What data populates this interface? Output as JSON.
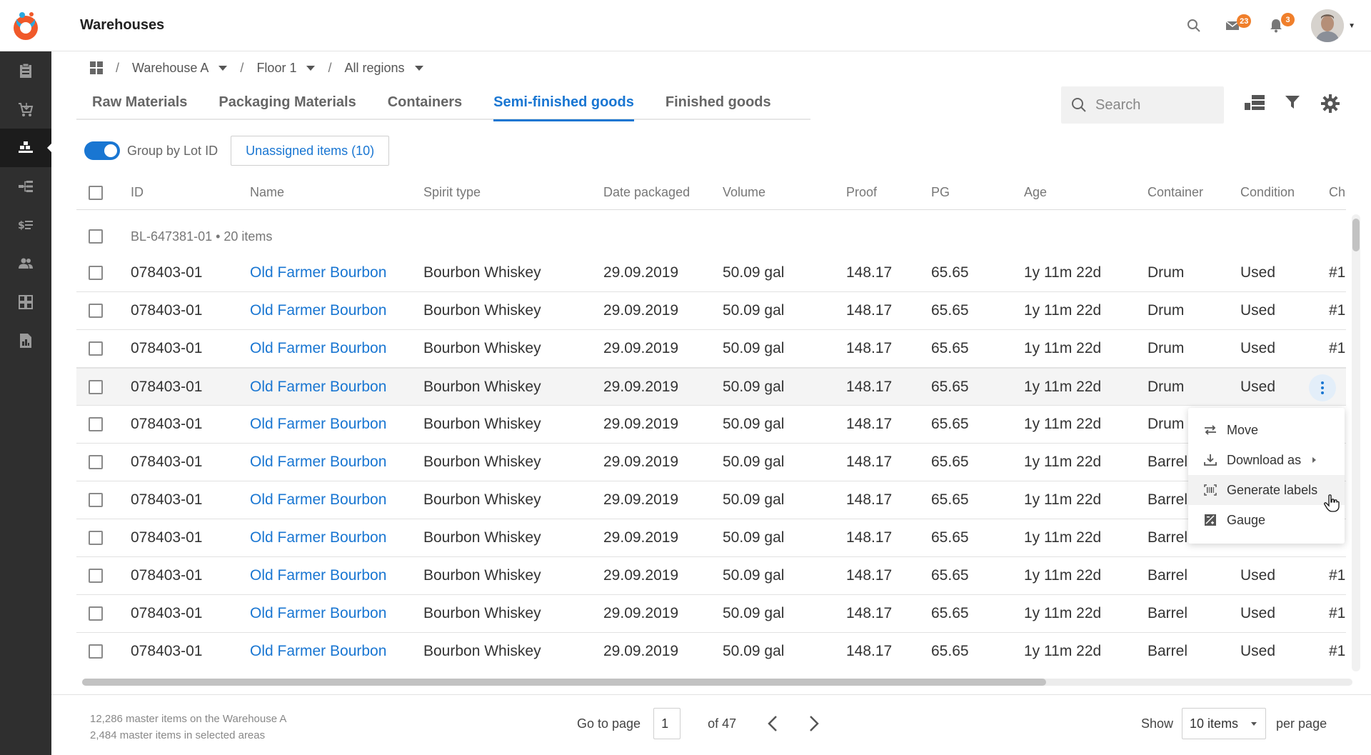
{
  "app": {
    "title": "Warehouses"
  },
  "topbar": {
    "search_icon": "search-icon",
    "mail_count": "23",
    "bell_count": "3"
  },
  "sidebar": {
    "items": [
      {
        "name": "clipboard-icon",
        "active": false
      },
      {
        "name": "cart-icon",
        "active": false
      },
      {
        "name": "warehouse-icon",
        "active": true
      },
      {
        "name": "hierarchy-icon",
        "active": false
      },
      {
        "name": "price-list-icon",
        "active": false
      },
      {
        "name": "users-icon",
        "active": false
      },
      {
        "name": "dashboard-icon",
        "active": false
      },
      {
        "name": "document-icon",
        "active": false
      }
    ]
  },
  "breadcrumb": {
    "warehouse": "Warehouse A",
    "floor": "Floor 1",
    "region": "All regions",
    "separator": "/"
  },
  "tabs": [
    {
      "label": "Raw Materials",
      "active": false
    },
    {
      "label": "Packaging Materials",
      "active": false
    },
    {
      "label": "Containers",
      "active": false
    },
    {
      "label": "Semi-finished goods",
      "active": true
    },
    {
      "label": "Finished goods",
      "active": false
    }
  ],
  "search": {
    "placeholder": "Search"
  },
  "toolbar": {
    "group_label": "Group by Lot ID",
    "group_enabled": true,
    "unassigned_label": "Unassigned items (10)"
  },
  "table": {
    "columns": [
      "ID",
      "Name",
      "Spirit type",
      "Date packaged",
      "Volume",
      "Proof",
      "PG",
      "Age",
      "Container",
      "Condition",
      "Ch"
    ],
    "group_label": "BL-647381-01 • 20 items",
    "rows": [
      [
        "078403-01",
        "Old Farmer Bourbon",
        "Bourbon Whiskey",
        "29.09.2019",
        "50.09 gal",
        "148.17",
        "65.65",
        "1y 11m 22d",
        "Drum",
        "Used",
        "#1"
      ],
      [
        "078403-01",
        "Old Farmer Bourbon",
        "Bourbon Whiskey",
        "29.09.2019",
        "50.09 gal",
        "148.17",
        "65.65",
        "1y 11m 22d",
        "Drum",
        "Used",
        "#1"
      ],
      [
        "078403-01",
        "Old Farmer Bourbon",
        "Bourbon Whiskey",
        "29.09.2019",
        "50.09 gal",
        "148.17",
        "65.65",
        "1y 11m 22d",
        "Drum",
        "Used",
        "#1"
      ],
      [
        "078403-01",
        "Old Farmer Bourbon",
        "Bourbon Whiskey",
        "29.09.2019",
        "50.09 gal",
        "148.17",
        "65.65",
        "1y 11m 22d",
        "Drum",
        "Used",
        ""
      ],
      [
        "078403-01",
        "Old Farmer Bourbon",
        "Bourbon Whiskey",
        "29.09.2019",
        "50.09 gal",
        "148.17",
        "65.65",
        "1y 11m 22d",
        "Drum",
        "",
        ""
      ],
      [
        "078403-01",
        "Old Farmer Bourbon",
        "Bourbon Whiskey",
        "29.09.2019",
        "50.09 gal",
        "148.17",
        "65.65",
        "1y 11m 22d",
        "Barrel",
        "",
        ""
      ],
      [
        "078403-01",
        "Old Farmer Bourbon",
        "Bourbon Whiskey",
        "29.09.2019",
        "50.09 gal",
        "148.17",
        "65.65",
        "1y 11m 22d",
        "Barrel",
        "",
        ""
      ],
      [
        "078403-01",
        "Old Farmer Bourbon",
        "Bourbon Whiskey",
        "29.09.2019",
        "50.09 gal",
        "148.17",
        "65.65",
        "1y 11m 22d",
        "Barrel",
        "",
        ""
      ],
      [
        "078403-01",
        "Old Farmer Bourbon",
        "Bourbon Whiskey",
        "29.09.2019",
        "50.09 gal",
        "148.17",
        "65.65",
        "1y 11m 22d",
        "Barrel",
        "Used",
        "#1"
      ],
      [
        "078403-01",
        "Old Farmer Bourbon",
        "Bourbon Whiskey",
        "29.09.2019",
        "50.09 gal",
        "148.17",
        "65.65",
        "1y 11m 22d",
        "Barrel",
        "Used",
        "#1"
      ],
      [
        "078403-01",
        "Old Farmer Bourbon",
        "Bourbon Whiskey",
        "29.09.2019",
        "50.09 gal",
        "148.17",
        "65.65",
        "1y 11m 22d",
        "Barrel",
        "Used",
        "#1"
      ]
    ],
    "hovered_row_index": 3
  },
  "context_menu": {
    "items": [
      {
        "label": "Move",
        "icon": "swap-icon",
        "submenu": false
      },
      {
        "label": "Download as",
        "icon": "download-icon",
        "submenu": true
      },
      {
        "label": "Generate labels",
        "icon": "barcode-icon",
        "submenu": false,
        "highlighted": true
      },
      {
        "label": "Gauge",
        "icon": "gauge-icon",
        "submenu": false
      }
    ]
  },
  "footer": {
    "info_line1": "12,286 master items on the Warehouse A",
    "info_line2": "2,484 master items in selected areas",
    "go_to_page": "Go to page",
    "current_page": "1",
    "of_total": "of 47",
    "show_label": "Show",
    "per_page_value": "10 items",
    "per_page_suffix": "per page"
  },
  "colors": {
    "accent": "#1976d2",
    "badge": "#f07f2b",
    "sidebar": "#2f2f2f"
  }
}
